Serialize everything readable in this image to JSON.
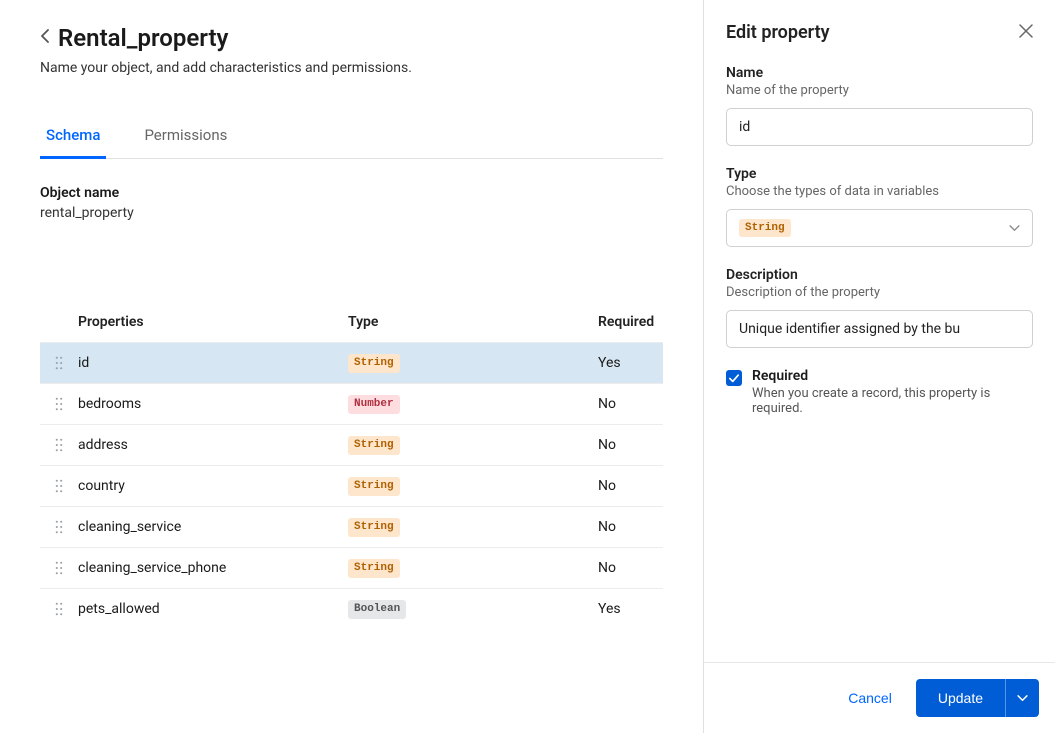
{
  "header": {
    "title": "Rental_property",
    "subtitle": "Name your object, and add characteristics and permissions."
  },
  "tabs": {
    "schema": "Schema",
    "permissions": "Permissions"
  },
  "object": {
    "label": "Object name",
    "value": "rental_property"
  },
  "columns": {
    "properties": "Properties",
    "type": "Type",
    "required": "Required"
  },
  "rows": [
    {
      "name": "id",
      "type": "String",
      "typeClass": "string",
      "required": "Yes",
      "selected": true
    },
    {
      "name": "bedrooms",
      "type": "Number",
      "typeClass": "number",
      "required": "No",
      "selected": false
    },
    {
      "name": "address",
      "type": "String",
      "typeClass": "string",
      "required": "No",
      "selected": false
    },
    {
      "name": "country",
      "type": "String",
      "typeClass": "string",
      "required": "No",
      "selected": false
    },
    {
      "name": "cleaning_service",
      "type": "String",
      "typeClass": "string",
      "required": "No",
      "selected": false
    },
    {
      "name": "cleaning_service_phone",
      "type": "String",
      "typeClass": "string",
      "required": "No",
      "selected": false
    },
    {
      "name": "pets_allowed",
      "type": "Boolean",
      "typeClass": "boolean",
      "required": "Yes",
      "selected": false
    }
  ],
  "panel": {
    "title": "Edit property",
    "name": {
      "label": "Name",
      "help": "Name of the property",
      "value": "id"
    },
    "type": {
      "label": "Type",
      "help": "Choose the types of data in variables",
      "value": "String"
    },
    "desc": {
      "label": "Description",
      "help": "Description of the property",
      "value": "Unique identifier assigned by the bu"
    },
    "required": {
      "label": "Required",
      "help": "When you create a record, this property is required."
    },
    "cancel": "Cancel",
    "update": "Update"
  }
}
